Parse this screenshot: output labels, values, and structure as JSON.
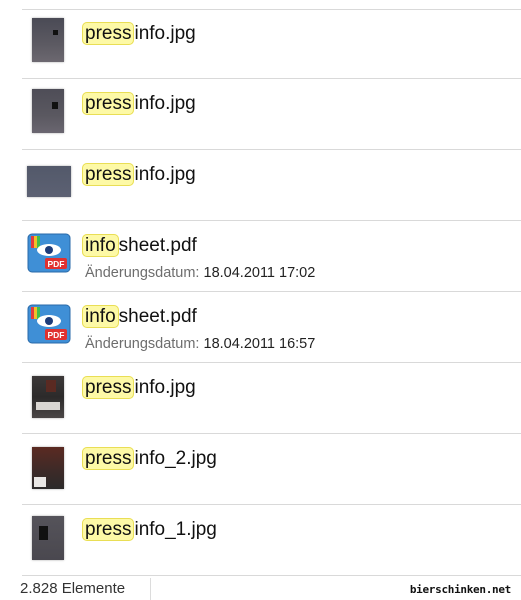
{
  "items": [
    {
      "highlight": "press",
      "rest": "info.jpg",
      "type": "jpg"
    },
    {
      "highlight": "press",
      "rest": "info.jpg",
      "type": "jpg"
    },
    {
      "highlight": "press",
      "rest": "info.jpg",
      "type": "jpg"
    },
    {
      "highlight": "info",
      "rest": "sheet.pdf",
      "type": "pdf",
      "meta_label": "Änderungsdatum:",
      "meta_value": "18.04.2011 17:02"
    },
    {
      "highlight": "info",
      "rest": "sheet.pdf",
      "type": "pdf",
      "meta_label": "Änderungsdatum:",
      "meta_value": "18.04.2011 16:57"
    },
    {
      "highlight": "press",
      "rest": "info.jpg",
      "type": "jpg"
    },
    {
      "highlight": "press",
      "rest": "info_2.jpg",
      "type": "jpg"
    },
    {
      "highlight": "press",
      "rest": "info_1.jpg",
      "type": "jpg"
    }
  ],
  "status": {
    "count": "2.828 Elemente"
  },
  "watermark": "bierschinken.net"
}
